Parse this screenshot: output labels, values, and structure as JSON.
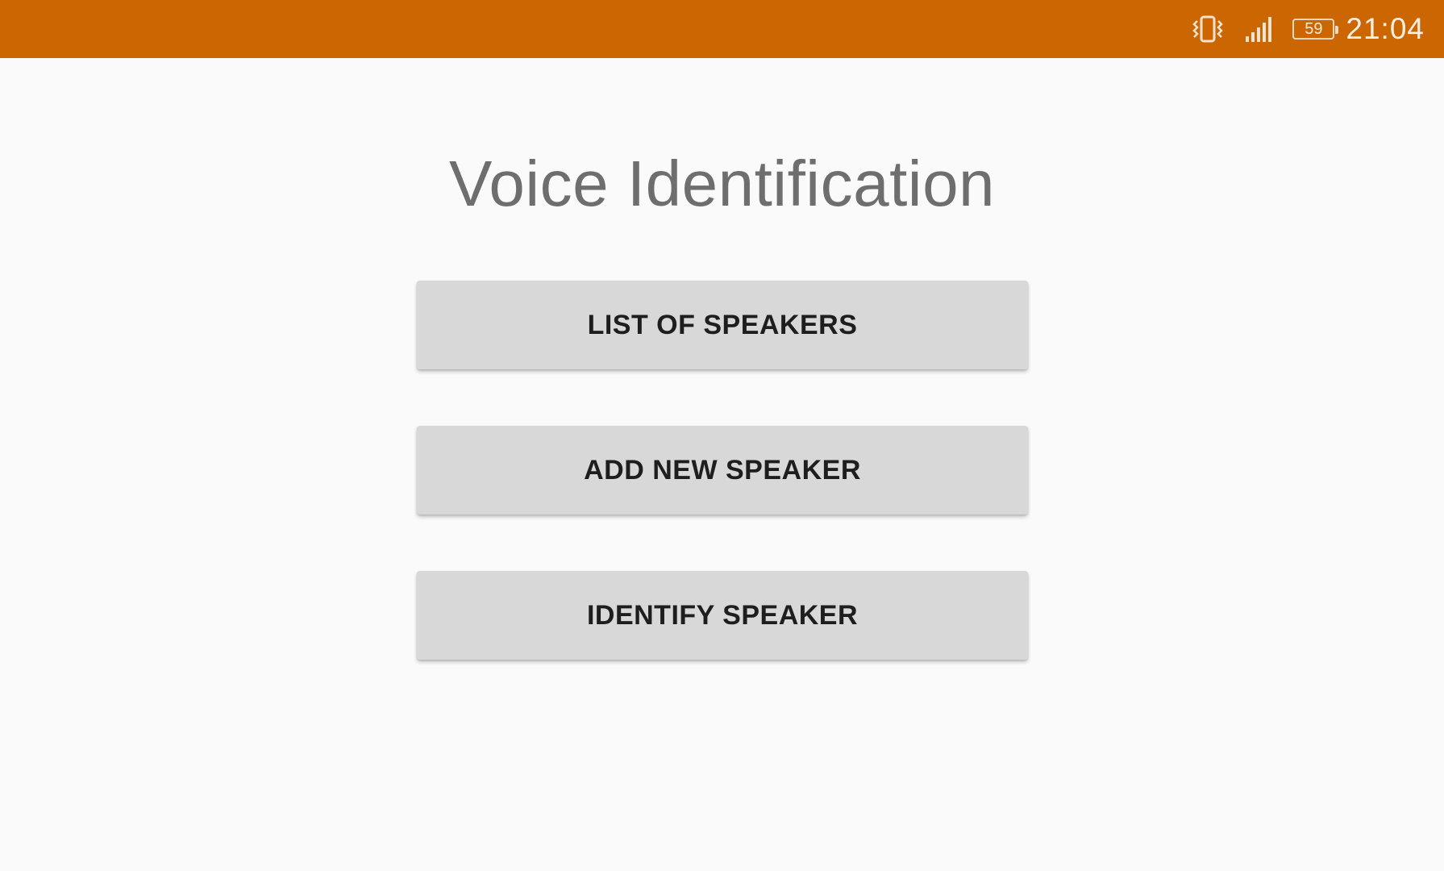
{
  "status_bar": {
    "background": "#cc6600",
    "icons": [
      "vibrate-icon",
      "signal-icon",
      "battery-icon"
    ],
    "battery_level": "59",
    "time": "21:04"
  },
  "main": {
    "title": "Voice Identification",
    "buttons": [
      {
        "label": "LIST OF SPEAKERS"
      },
      {
        "label": "ADD NEW SPEAKER"
      },
      {
        "label": "IDENTIFY SPEAKER"
      }
    ]
  },
  "colors": {
    "accent": "#cc6600",
    "button_bg": "#d8d8d8",
    "title_text": "#6e6e6e",
    "background": "#fafafa"
  }
}
